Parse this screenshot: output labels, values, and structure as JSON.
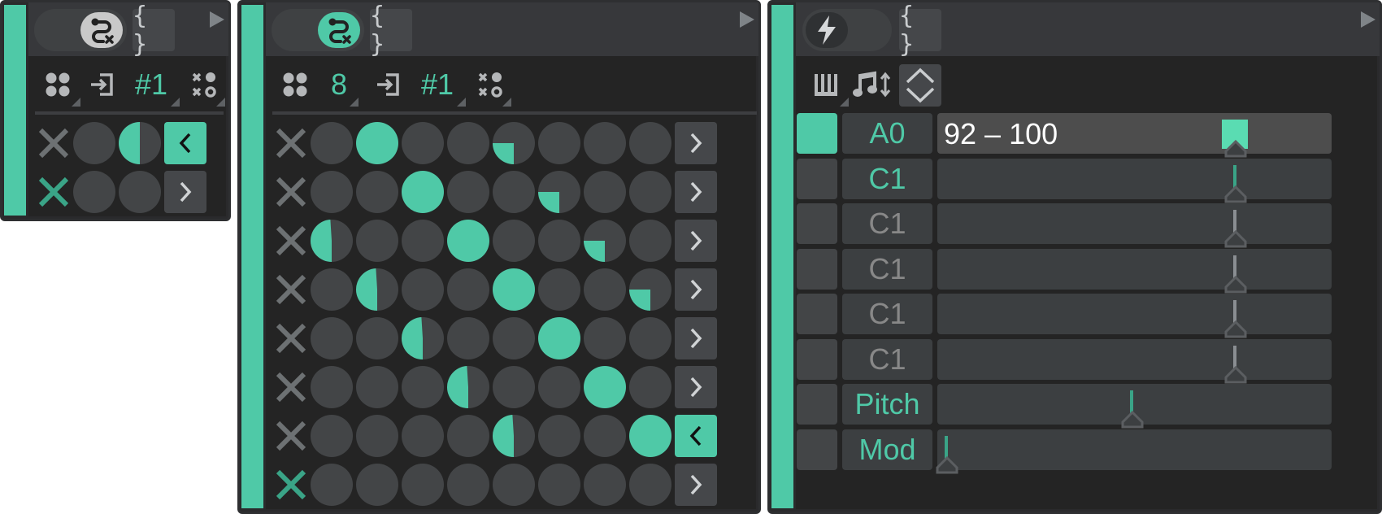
{
  "colors": {
    "accent": "#4fc9a7",
    "accent_dim": "#3aa487",
    "circle_off": "#434547",
    "text_muted": "#888888",
    "value_text": "#ffffff"
  },
  "panel1": {
    "header": {
      "toggle_icon": "route-x-icon",
      "toggle_state": "on",
      "brace_label": "{ }",
      "play_icon": "play-icon"
    },
    "toolbar": {
      "pattern_icon": "four-dots-icon",
      "input_icon": "input-arrow-icon",
      "channel_label": "#1",
      "mode_icon": "x-dot-grid-icon"
    },
    "grid": {
      "columns": 2,
      "rows": [
        {
          "mute": "inactive",
          "fills": [
            0,
            0.5
          ],
          "nav": "<",
          "nav_active": true
        },
        {
          "mute": "active",
          "fills": [
            0,
            0
          ],
          "nav": ">",
          "nav_active": false
        }
      ]
    }
  },
  "panel2": {
    "header": {
      "toggle_icon": "route-x-icon",
      "toggle_state": "on",
      "brace_label": "{ }",
      "play_icon": "play-icon"
    },
    "toolbar": {
      "pattern_icon": "four-dots-icon",
      "steps_label": "8",
      "input_icon": "input-arrow-icon",
      "channel_label": "#1",
      "mode_icon": "x-dot-grid-icon"
    },
    "grid": {
      "columns": 8,
      "rows": [
        {
          "mute": "inactive",
          "fills": [
            0,
            1,
            0,
            0,
            0.25,
            0,
            0,
            0
          ],
          "nav": ">",
          "nav_active": false
        },
        {
          "mute": "inactive",
          "fills": [
            0,
            0,
            1,
            0,
            0,
            0.25,
            0,
            0
          ],
          "nav": ">",
          "nav_active": false
        },
        {
          "mute": "inactive",
          "fills": [
            0.49,
            0,
            0,
            1,
            0,
            0,
            0.25,
            0
          ],
          "nav": ">",
          "nav_active": false
        },
        {
          "mute": "inactive",
          "fills": [
            0,
            0.49,
            0,
            0,
            1,
            0,
            0,
            0.25
          ],
          "nav": ">",
          "nav_active": false
        },
        {
          "mute": "inactive",
          "fills": [
            0,
            0,
            0.49,
            0,
            0,
            1,
            0,
            0
          ],
          "nav": ">",
          "nav_active": false
        },
        {
          "mute": "inactive",
          "fills": [
            0,
            0,
            0,
            0.49,
            0,
            0,
            1,
            0
          ],
          "nav": ">",
          "nav_active": false
        },
        {
          "mute": "inactive",
          "fills": [
            0,
            0,
            0,
            0,
            0.49,
            0,
            0,
            1
          ],
          "nav": "<",
          "nav_active": true
        },
        {
          "mute": "active",
          "fills": [
            0,
            0,
            0,
            0,
            0,
            0,
            0,
            0
          ],
          "nav": ">",
          "nav_active": false
        }
      ]
    }
  },
  "panel3": {
    "header": {
      "toggle_icon": "lightning-icon",
      "toggle_state": "off",
      "brace_label": "{ }",
      "play_icon": "play-icon"
    },
    "toolbar": {
      "keys_icon": "piano-keys-icon",
      "note_icon": "note-updown-icon",
      "stepper_icon": "chevron-up-down-icon"
    },
    "rows": [
      {
        "selected": true,
        "note": "A0",
        "note_style": "accent",
        "range_text": "92 – 100",
        "range_value": 0.78,
        "marker": "block",
        "marker_color": "accent"
      },
      {
        "selected": false,
        "note": "C1",
        "note_style": "accent",
        "range_text": "",
        "range_value": 0.78,
        "marker": "line",
        "marker_color": "accent"
      },
      {
        "selected": false,
        "note": "C1",
        "note_style": "muted",
        "range_text": "",
        "range_value": 0.78,
        "marker": "line",
        "marker_color": "muted"
      },
      {
        "selected": false,
        "note": "C1",
        "note_style": "muted",
        "range_text": "",
        "range_value": 0.78,
        "marker": "line",
        "marker_color": "muted"
      },
      {
        "selected": false,
        "note": "C1",
        "note_style": "muted",
        "range_text": "",
        "range_value": 0.78,
        "marker": "line",
        "marker_color": "muted"
      },
      {
        "selected": false,
        "note": "C1",
        "note_style": "muted",
        "range_text": "",
        "range_value": 0.78,
        "marker": "line",
        "marker_color": "muted"
      },
      {
        "selected": false,
        "note": "Pitch",
        "note_style": "accent",
        "range_text": "",
        "range_value": 0.5,
        "marker": "line",
        "marker_color": "accent"
      },
      {
        "selected": false,
        "note": "Mod",
        "note_style": "accent",
        "range_text": "",
        "range_value": 0.0,
        "marker": "line",
        "marker_color": "accent"
      }
    ]
  }
}
